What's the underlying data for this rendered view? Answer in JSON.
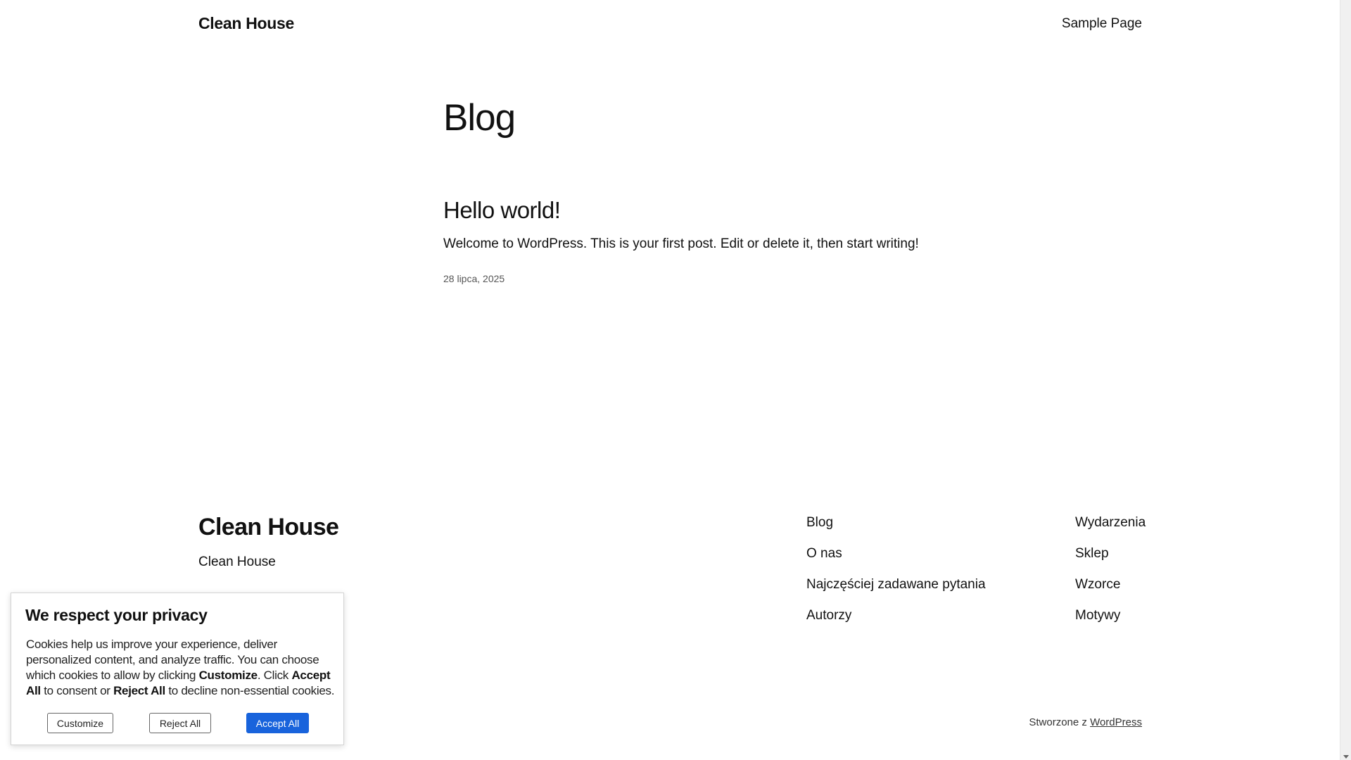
{
  "header": {
    "site_title": "Clean House",
    "nav": [
      "Sample Page"
    ]
  },
  "main": {
    "page_title": "Blog",
    "post": {
      "title": "Hello world!",
      "excerpt": "Welcome to WordPress. This is your first post. Edit or delete it, then start writing!",
      "date": "28 lipca, 2025"
    }
  },
  "footer": {
    "brand_title": "Clean House",
    "tagline": "Clean House",
    "nav_col1": [
      "Blog",
      "O nas",
      "Najczęściej zadawane pytania",
      "Autorzy"
    ],
    "nav_col2": [
      "Wydarzenia",
      "Sklep",
      "Wzorce",
      "Motywy"
    ],
    "credit_prefix": "Stworzone z ",
    "credit_link": "WordPress"
  },
  "cookie": {
    "title": "We respect your privacy",
    "text_1": "Cookies help us improve your experience, deliver personalized content, and analyze traffic. You can choose which cookies to allow by clicking ",
    "bold_customize": "Customize",
    "text_2": ". Click ",
    "bold_accept": "Accept All",
    "text_3": " to consent or ",
    "bold_reject": "Reject All",
    "text_4": " to decline non-essential cookies.",
    "customize_label": "Customize",
    "reject_label": "Reject All",
    "accept_label": "Accept All"
  },
  "colors": {
    "accent": "#1863dc",
    "text": "#111111",
    "background": "#ffffff"
  }
}
